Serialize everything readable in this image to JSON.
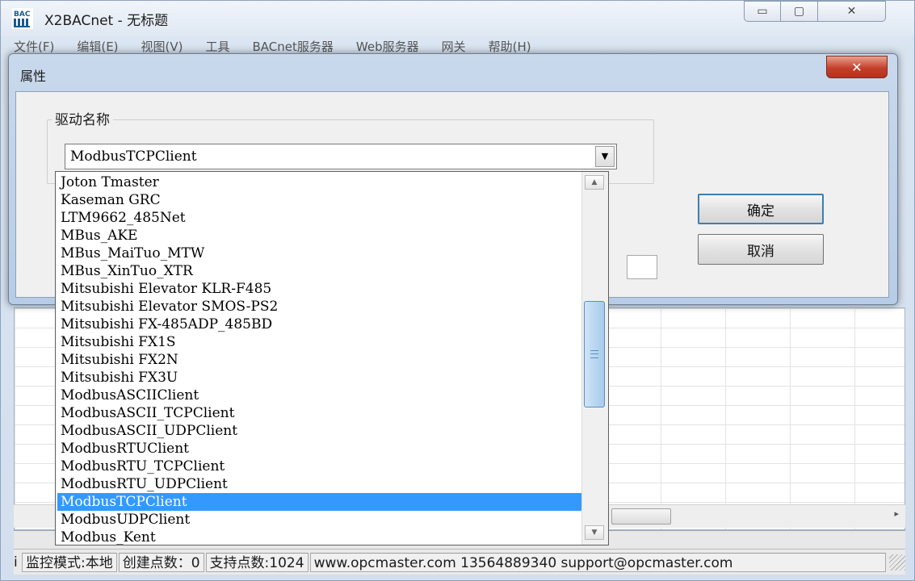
{
  "window": {
    "title": "X2BACnet - 无标题",
    "icon_label": "BAC",
    "controls": {
      "minimize": "▭",
      "maximize": "▢",
      "close": "✕"
    }
  },
  "menubar": [
    "文件(F)",
    "编辑(E)",
    "视图(V)",
    "工具",
    "BACnet服务器",
    "Web服务器",
    "网关",
    "帮助(H)"
  ],
  "dialog": {
    "title": "属性",
    "close_symbol": "✕",
    "group_label": "驱动名称",
    "combo_value": "ModbusTCPClient",
    "ok_label": "确定",
    "cancel_label": "取消"
  },
  "dropdown": {
    "items": [
      "Joton Tmaster",
      "Kaseman GRC",
      "LTM9662_485Net",
      "MBus_AKE",
      "MBus_MaiTuo_MTW",
      "MBus_XinTuo_XTR",
      "Mitsubishi Elevator KLR-F485",
      "Mitsubishi Elevator SMOS-PS2",
      "Mitsubishi FX-485ADP_485BD",
      "Mitsubishi FX1S",
      "Mitsubishi FX2N",
      "Mitsubishi FX3U",
      "ModbusASCIIClient",
      "ModbusASCII_TCPClient",
      "ModbusASCII_UDPClient",
      "ModbusRTUClient",
      "ModbusRTU_TCPClient",
      "ModbusRTU_UDPClient",
      "ModbusTCPClient",
      "ModbusUDPClient",
      "Modbus_Kent"
    ],
    "selected": "ModbusTCPClient"
  },
  "statusbar": {
    "left_fragment": "i",
    "mode": "监控模式:本地",
    "points_created": "创建点数：0",
    "points_supported": "支持点数:1024",
    "contact": "www.opcmaster.com 13564889340 support@opcmaster.com"
  },
  "colors": {
    "selection": "#3399ff",
    "dialog_close": "#c5402b",
    "ok_focus_border": "#3c7fb1"
  }
}
